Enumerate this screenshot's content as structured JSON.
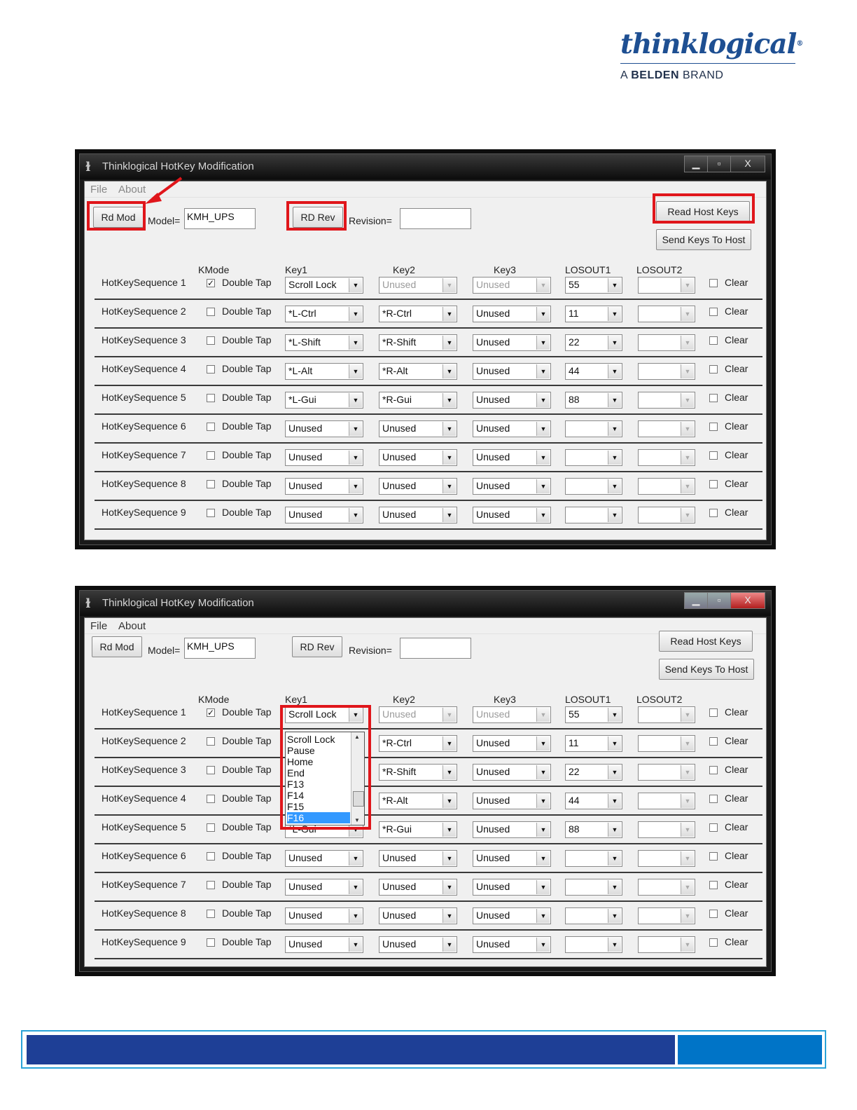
{
  "brand": {
    "name": "thinklogical",
    "registered": "®",
    "tagline_prefix": "A ",
    "tagline_brand": "BELDEN",
    "tagline_suffix": " BRAND",
    "color": "#1e4f92"
  },
  "window": {
    "title": "Thinklogical HotKey Modification",
    "minimize": "▁",
    "maximize": "▫",
    "close": "X",
    "menu": [
      "File",
      "About"
    ],
    "rd_mod": "Rd Mod",
    "model_label": "Model=",
    "model_value": "KMH_UPS",
    "rd_rev": "RD Rev",
    "revision_label": "Revision=",
    "revision_value": "",
    "read_host_keys": "Read Host Keys",
    "send_keys_to_host": "Send Keys To Host",
    "columns": {
      "kmode": "KMode",
      "key1": "Key1",
      "key2": "Key2",
      "key3": "Key3",
      "losout1": "LOSOUT1",
      "losout2": "LOSOUT2"
    },
    "double_tap_label": "Double Tap",
    "clear_label": "Clear",
    "rows": [
      {
        "name": "HotKeySequence 1",
        "checked": true,
        "key1": "Scroll Lock",
        "key2": "Unused",
        "key2_disabled": true,
        "key3": "Unused",
        "key3_disabled": true,
        "losout1": "55",
        "losout2": ""
      },
      {
        "name": "HotKeySequence 2",
        "checked": false,
        "key1": "*L-Ctrl",
        "key2": "*R-Ctrl",
        "key2_disabled": false,
        "key3": "Unused",
        "key3_disabled": false,
        "losout1": "11",
        "losout2": ""
      },
      {
        "name": "HotKeySequence 3",
        "checked": false,
        "key1": "*L-Shift",
        "key2": "*R-Shift",
        "key2_disabled": false,
        "key3": "Unused",
        "key3_disabled": false,
        "losout1": "22",
        "losout2": ""
      },
      {
        "name": "HotKeySequence 4",
        "checked": false,
        "key1": "*L-Alt",
        "key2": "*R-Alt",
        "key2_disabled": false,
        "key3": "Unused",
        "key3_disabled": false,
        "losout1": "44",
        "losout2": ""
      },
      {
        "name": "HotKeySequence 5",
        "checked": false,
        "key1": "*L-Gui",
        "key2": "*R-Gui",
        "key2_disabled": false,
        "key3": "Unused",
        "key3_disabled": false,
        "losout1": "88",
        "losout2": ""
      },
      {
        "name": "HotKeySequence 6",
        "checked": false,
        "key1": "Unused",
        "key2": "Unused",
        "key2_disabled": false,
        "key3": "Unused",
        "key3_disabled": false,
        "losout1": "",
        "losout2": ""
      },
      {
        "name": "HotKeySequence 7",
        "checked": false,
        "key1": "Unused",
        "key2": "Unused",
        "key2_disabled": false,
        "key3": "Unused",
        "key3_disabled": false,
        "losout1": "",
        "losout2": ""
      },
      {
        "name": "HotKeySequence 8",
        "checked": false,
        "key1": "Unused",
        "key2": "Unused",
        "key2_disabled": false,
        "key3": "Unused",
        "key3_disabled": false,
        "losout1": "",
        "losout2": ""
      },
      {
        "name": "HotKeySequence 9",
        "checked": false,
        "key1": "Unused",
        "key2": "Unused",
        "key2_disabled": false,
        "key3": "Unused",
        "key3_disabled": false,
        "losout1": "",
        "losout2": ""
      }
    ]
  },
  "dropdown": {
    "items": [
      "Scroll Lock",
      "Pause",
      "Home",
      "End",
      "F13",
      "F14",
      "F15",
      "F16"
    ],
    "selected": "F16"
  },
  "colors": {
    "highlight": "#e0161b",
    "footer_left": "#1e3f96",
    "footer_right": "#0074c7",
    "footer_border": "#29a3d8"
  }
}
